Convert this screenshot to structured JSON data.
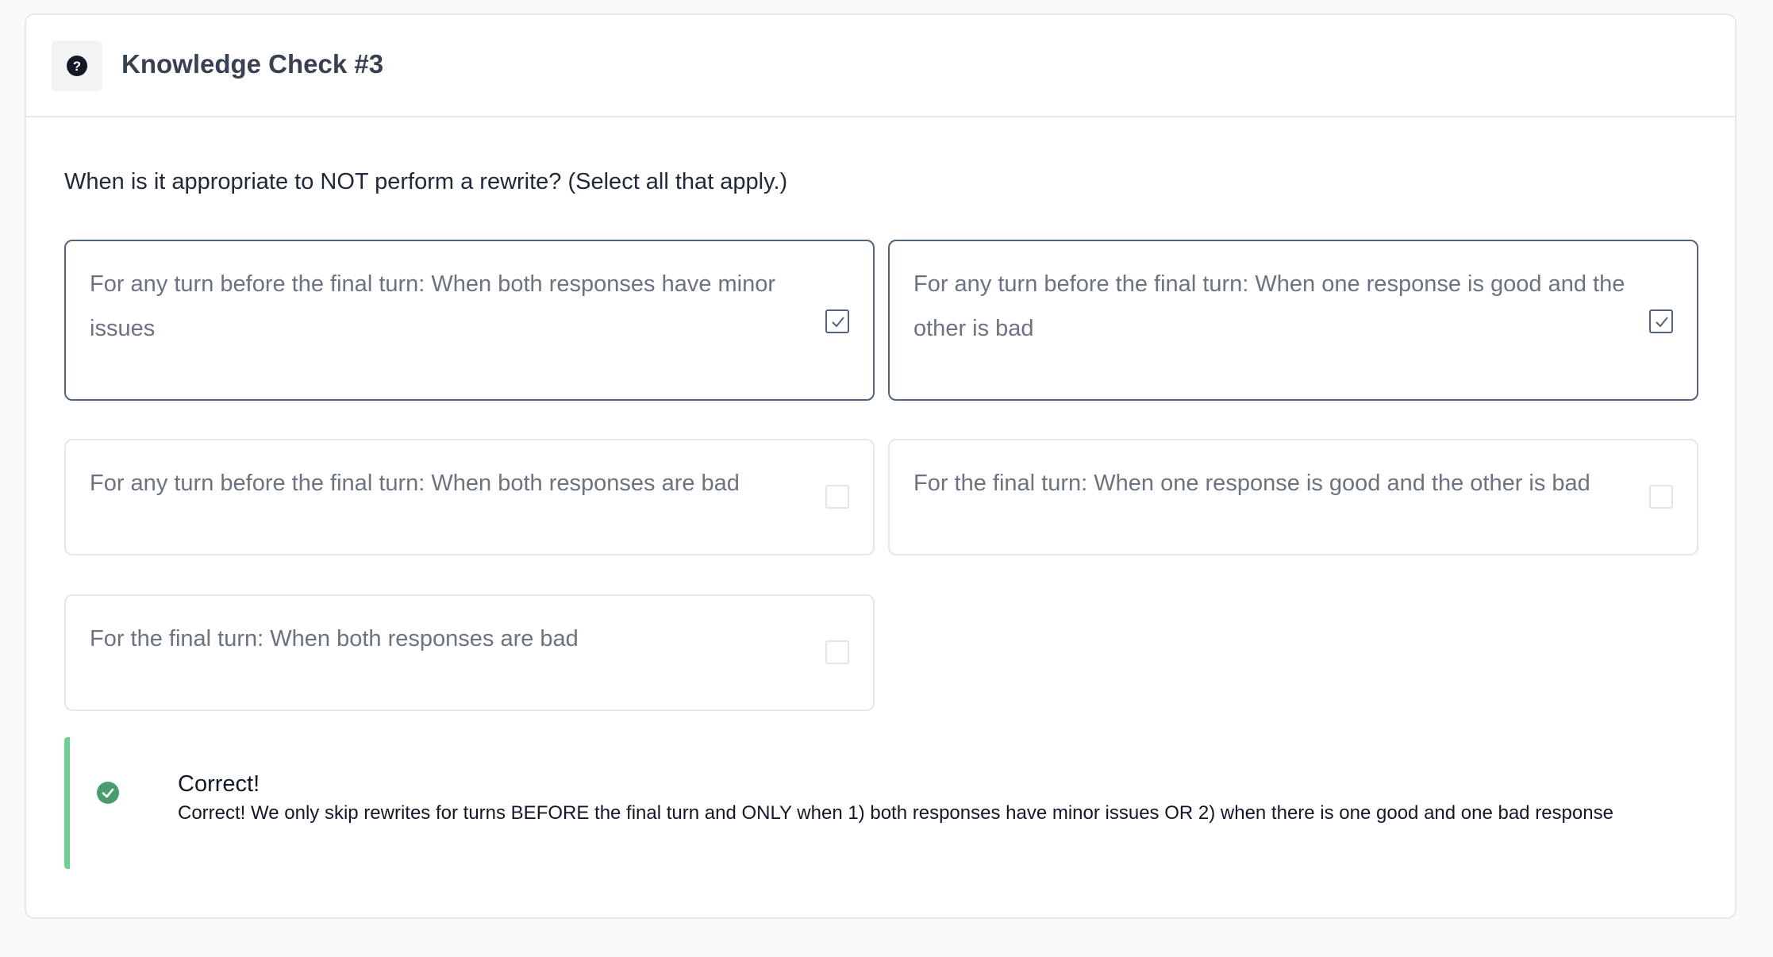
{
  "header": {
    "icon": "question-circle-icon",
    "title": "Knowledge Check #3"
  },
  "question": "When is it appropriate to NOT perform a rewrite? (Select all that apply.)",
  "options": [
    {
      "label": "For any turn before the final turn: When both responses have minor issues",
      "checked": true
    },
    {
      "label": "For any turn before the final turn: When one response is good and the other is bad",
      "checked": true
    },
    {
      "label": "For any turn before the final turn: When both responses are bad",
      "checked": false
    },
    {
      "label": "For the final turn: When one response is good and the other is bad",
      "checked": false
    },
    {
      "label": "For the final turn: When both responses are bad",
      "checked": false
    }
  ],
  "feedback": {
    "icon": "check-circle-icon",
    "title": "Correct!",
    "message": "Correct! We only skip rewrites for turns BEFORE the final turn and ONLY when 1) both responses have minor issues OR 2) when there is one good and one bad response",
    "accent_color": "#6fcf97",
    "icon_color": "#4a9b6e"
  }
}
